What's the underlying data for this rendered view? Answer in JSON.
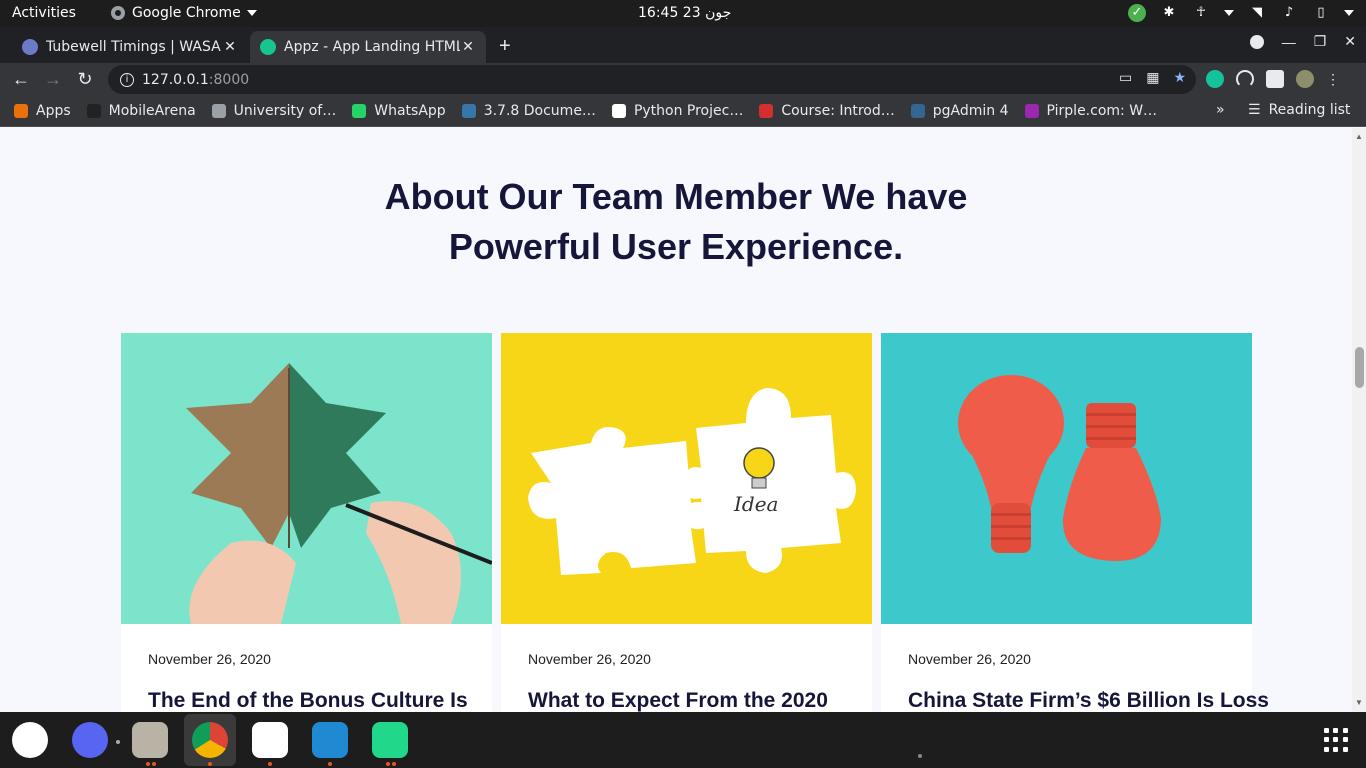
{
  "system_bar": {
    "activities": "Activities",
    "app_name": "Google Chrome",
    "clock": "16:45  جون 23"
  },
  "tabs": [
    {
      "title": "Tubewell Timings | WASA",
      "favicon": "wasa-icon"
    },
    {
      "title": "Appz - App Landing HTML",
      "favicon": "appz-icon"
    }
  ],
  "address_bar": {
    "host": "127.0.0.1",
    "port": ":8000"
  },
  "bookmarks": [
    {
      "label": "Apps",
      "icon": "apps-grid-icon",
      "color": "#e8710a"
    },
    {
      "label": "MobileArena",
      "icon": "mobilearena-icon",
      "color": "#222222"
    },
    {
      "label": "University of…",
      "icon": "globe-icon",
      "color": "#9aa0a6"
    },
    {
      "label": "WhatsApp",
      "icon": "whatsapp-icon",
      "color": "#25d366"
    },
    {
      "label": "3.7.8 Docume…",
      "icon": "python-icon",
      "color": "#3776ab"
    },
    {
      "label": "Python Projec…",
      "icon": "python-project-icon",
      "color": "#ffffff"
    },
    {
      "label": "Course: Introd…",
      "icon": "course-icon",
      "color": "#d32f2f"
    },
    {
      "label": "pgAdmin 4",
      "icon": "pgadmin-icon",
      "color": "#336791"
    },
    {
      "label": "Pirple.com: W…",
      "icon": "pirple-icon",
      "color": "#9c27b0"
    }
  ],
  "bookmarks_more": "»",
  "reading_list": "Reading list",
  "page": {
    "heading_line1": "About Our Team Member We have",
    "heading_line2": "Powerful User Experience.",
    "cards": [
      {
        "date": "November 26, 2020",
        "title": "The End of the Bonus Culture Is",
        "image": "leaf-drawing-image"
      },
      {
        "date": "November 26, 2020",
        "title": "What to Expect From the 2020",
        "image": "puzzle-idea-image",
        "image_text": "Idea"
      },
      {
        "date": "November 26, 2020",
        "title": "China State Firm’s $6 Billion Is Loss",
        "image": "red-light-bulbs-image"
      }
    ]
  },
  "colors": {
    "heading": "#16163b",
    "page_bg": "#f6f8fd",
    "chrome_dark": "#202124",
    "chrome_toolbar": "#35363a"
  }
}
